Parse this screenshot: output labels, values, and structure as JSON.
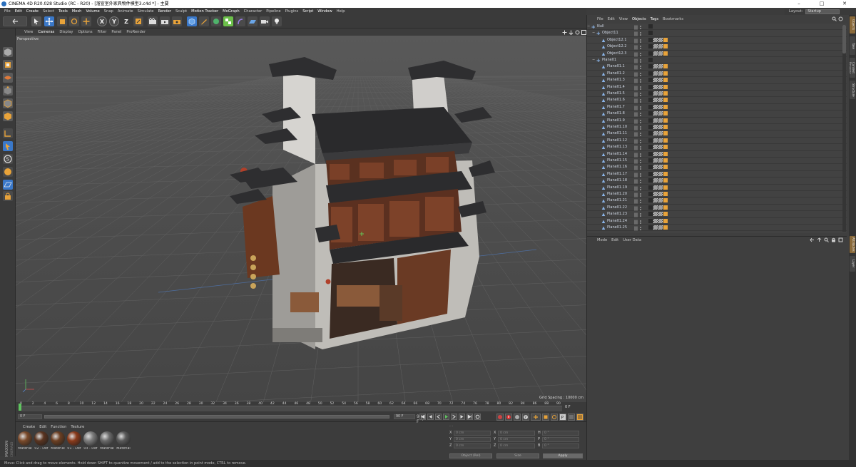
{
  "window": {
    "title": "CINEMA 4D R20.028 Studio (RC - R20) - [溜宣室外家具物件模型3.c4d *] - 主要",
    "controls": [
      "–",
      "□",
      "✕"
    ]
  },
  "menubar": {
    "items": [
      "File",
      "Edit",
      "Create",
      "Select",
      "Tools",
      "Mesh",
      "Volume",
      "Snap",
      "Animate",
      "Simulate",
      "Render",
      "Sculpt",
      "Motion Tracker",
      "MoGraph",
      "Character",
      "Pipeline",
      "Plugins",
      "Script",
      "Window",
      "Help"
    ],
    "highlighted": [
      "Edit",
      "Create",
      "Tools",
      "Mesh",
      "Volume",
      "Render",
      "Motion Tracker",
      "MoGraph",
      "Script",
      "Window"
    ]
  },
  "layout": {
    "label": "Layout:",
    "value": "Startup"
  },
  "toolbar": {
    "axis_x": "X",
    "axis_y": "Y",
    "axis_z": "Z"
  },
  "viewport": {
    "menu": [
      "View",
      "Cameras",
      "Display",
      "Options",
      "Filter",
      "Panel",
      "ProRender"
    ],
    "active_menu": "Cameras",
    "label": "Perspective",
    "grid_spacing": "Grid Spacing : 10000 cm"
  },
  "timeline": {
    "ticks": [
      "0",
      "2",
      "4",
      "6",
      "8",
      "10",
      "12",
      "14",
      "16",
      "18",
      "20",
      "22",
      "24",
      "26",
      "28",
      "30",
      "32",
      "34",
      "36",
      "38",
      "40",
      "42",
      "44",
      "46",
      "48",
      "50",
      "52",
      "54",
      "56",
      "58",
      "60",
      "62",
      "64",
      "66",
      "68",
      "70",
      "72",
      "74",
      "76",
      "78",
      "80",
      "82",
      "84",
      "86",
      "88",
      "90"
    ],
    "current_frame_readout": "0 F",
    "start_field": "0 F",
    "end_field": "90 F",
    "end_field2": "90 F",
    "start_field2": "0 F"
  },
  "materials": {
    "menu": [
      "Create",
      "Edit",
      "Function",
      "Texture"
    ],
    "items": [
      {
        "name": "Material",
        "color": "#7a4a2a"
      },
      {
        "name": "02 - Def",
        "color": "#5a3420"
      },
      {
        "name": "Material",
        "color": "#6b3f22"
      },
      {
        "name": "01 - Def",
        "color": "#8a3a1a"
      },
      {
        "name": "03 - Def",
        "color": "#7c7c7c"
      },
      {
        "name": "Material",
        "color": "#6a6a6a"
      },
      {
        "name": "Material",
        "color": "#5a5a5a"
      }
    ]
  },
  "coords": {
    "rows": [
      {
        "axis": "X",
        "pos": "0 cm",
        "axis2": "X",
        "size": "0 cm",
        "axis3": "H",
        "rot": "0 °"
      },
      {
        "axis": "Y",
        "pos": "0 cm",
        "axis2": "Y",
        "size": "0 cm",
        "axis3": "P",
        "rot": "0 °"
      },
      {
        "axis": "Z",
        "pos": "0 cm",
        "axis2": "Z",
        "size": "0 cm",
        "axis3": "B",
        "rot": "0 °"
      }
    ],
    "mode_select": "Object (Rel)",
    "size_select": "Size",
    "apply": "Apply",
    "header": "- -"
  },
  "object_manager": {
    "menu": [
      "File",
      "Edit",
      "View",
      "Objects",
      "Tags",
      "Bookmarks"
    ],
    "highlighted": [
      "Objects",
      "Tags"
    ],
    "rows": [
      {
        "name": "Null",
        "level": 0,
        "type": "null"
      },
      {
        "name": "Object11",
        "level": 1,
        "type": "null"
      },
      {
        "name": "Object12.1",
        "level": 2,
        "type": "poly"
      },
      {
        "name": "Object12.2",
        "level": 2,
        "type": "poly"
      },
      {
        "name": "Object12.3",
        "level": 2,
        "type": "poly"
      },
      {
        "name": "Plane01",
        "level": 1,
        "type": "null"
      },
      {
        "name": "Plane01.1",
        "level": 2,
        "type": "poly"
      },
      {
        "name": "Plane01.2",
        "level": 2,
        "type": "poly"
      },
      {
        "name": "Plane01.3",
        "level": 2,
        "type": "poly"
      },
      {
        "name": "Plane01.4",
        "level": 2,
        "type": "poly"
      },
      {
        "name": "Plane01.5",
        "level": 2,
        "type": "poly"
      },
      {
        "name": "Plane01.6",
        "level": 2,
        "type": "poly"
      },
      {
        "name": "Plane01.7",
        "level": 2,
        "type": "poly"
      },
      {
        "name": "Plane01.8",
        "level": 2,
        "type": "poly"
      },
      {
        "name": "Plane01.9",
        "level": 2,
        "type": "poly"
      },
      {
        "name": "Plane01.10",
        "level": 2,
        "type": "poly"
      },
      {
        "name": "Plane01.11",
        "level": 2,
        "type": "poly"
      },
      {
        "name": "Plane01.12",
        "level": 2,
        "type": "poly"
      },
      {
        "name": "Plane01.13",
        "level": 2,
        "type": "poly"
      },
      {
        "name": "Plane01.14",
        "level": 2,
        "type": "poly"
      },
      {
        "name": "Plane01.15",
        "level": 2,
        "type": "poly"
      },
      {
        "name": "Plane01.16",
        "level": 2,
        "type": "poly"
      },
      {
        "name": "Plane01.17",
        "level": 2,
        "type": "poly"
      },
      {
        "name": "Plane01.18",
        "level": 2,
        "type": "poly"
      },
      {
        "name": "Plane01.19",
        "level": 2,
        "type": "poly"
      },
      {
        "name": "Plane01.20",
        "level": 2,
        "type": "poly"
      },
      {
        "name": "Plane01.21",
        "level": 2,
        "type": "poly"
      },
      {
        "name": "Plane01.22",
        "level": 2,
        "type": "poly"
      },
      {
        "name": "Plane01.23",
        "level": 2,
        "type": "poly"
      },
      {
        "name": "Plane01.24",
        "level": 2,
        "type": "poly"
      },
      {
        "name": "Plane01.25",
        "level": 2,
        "type": "poly"
      }
    ]
  },
  "attribute_manager": {
    "menu": [
      "Mode",
      "Edit",
      "User Data"
    ]
  },
  "side_tabs": [
    "Objects",
    "Take",
    "Content Browser",
    "Structure",
    "Attributes",
    "Layer"
  ],
  "status": "Move: Click and drag to move elements. Hold down SHIFT to quantize movement / add to the selection in point mode, CTRL to remove.",
  "colors": {
    "accent": "#e8a33a",
    "blue_icon": "#3a78c9",
    "background": "#3c3c3c",
    "viewport": "#4b4b4b"
  }
}
